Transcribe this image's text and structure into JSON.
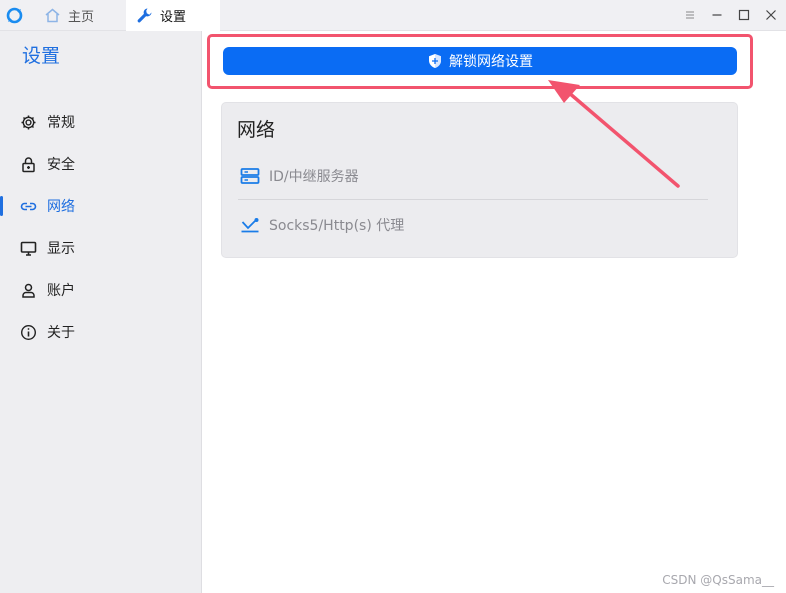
{
  "titlebar": {
    "tabs": [
      {
        "label": "主页"
      },
      {
        "label": "设置"
      }
    ]
  },
  "sidebar": {
    "title": "设置",
    "items": [
      {
        "label": "常规",
        "icon": "gear-icon"
      },
      {
        "label": "安全",
        "icon": "lock-icon"
      },
      {
        "label": "网络",
        "icon": "link-icon",
        "active": true
      },
      {
        "label": "显示",
        "icon": "monitor-icon"
      },
      {
        "label": "账户",
        "icon": "user-icon"
      },
      {
        "label": "关于",
        "icon": "info-icon"
      }
    ]
  },
  "main": {
    "unlock_button_label": "解锁网络设置",
    "network_card": {
      "title": "网络",
      "rows": [
        {
          "label": "ID/中继服务器",
          "icon": "server-icon"
        },
        {
          "label": "Socks5/Http(s) 代理",
          "icon": "proxy-icon"
        }
      ]
    }
  },
  "watermark": "CSDN @QsSama__",
  "colors": {
    "accent": "#1f6fe0",
    "button": "#0a6cf4",
    "highlight": "#f2546e"
  }
}
